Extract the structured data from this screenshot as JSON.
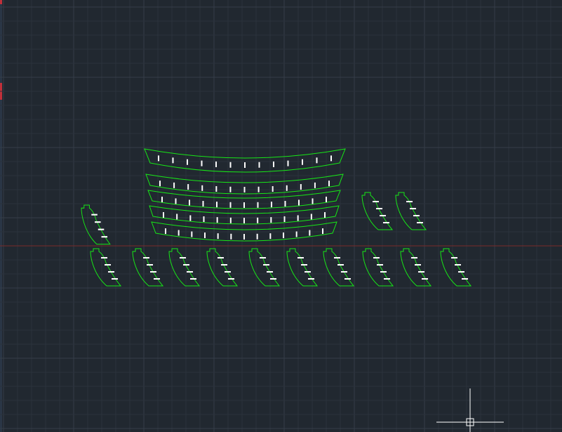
{
  "app": {
    "view": "model-space-drawing-canvas"
  },
  "canvas": {
    "background_color": "#212830",
    "grid_minor_color": "#2b323c",
    "grid_major_color": "#353d48",
    "outline_color": "#17e617",
    "mark_color": "#ffffff",
    "x_axis_color": "#7a2a2a",
    "cursor_color": "#ffffff",
    "cursor": "crosshair-pickbox-icon",
    "left_edge_accent_color": "#c0303a"
  },
  "drawing": {
    "arc_strip_count": 5,
    "arc_strip_tick_counts": [
      13,
      13,
      13,
      13,
      13
    ],
    "blade_count": 13,
    "blade_tick_counts": [
      4,
      4,
      4,
      4,
      4,
      4,
      4,
      4,
      4,
      4,
      4,
      4,
      4
    ]
  }
}
